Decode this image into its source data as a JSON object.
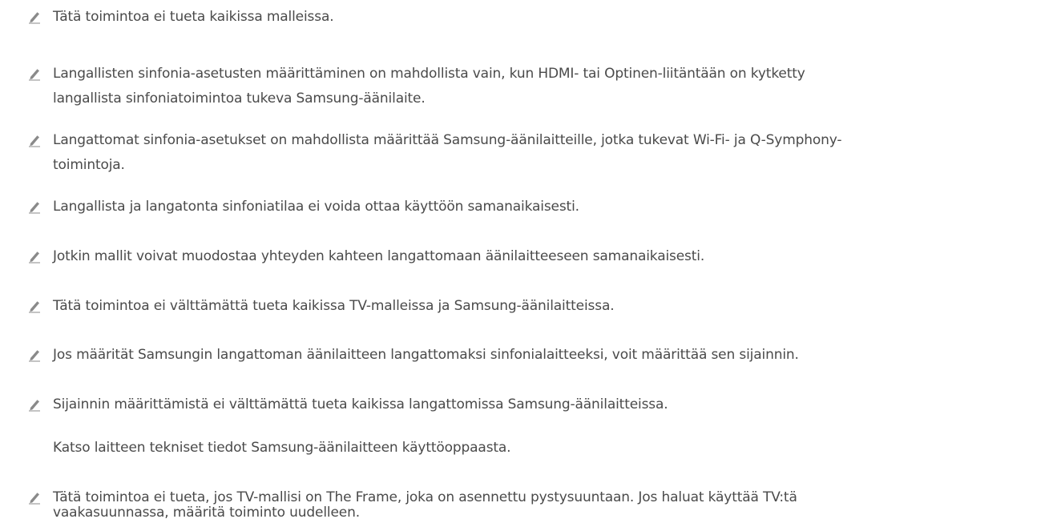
{
  "notes": [
    {
      "lines": [
        "Tätä toimintoa ei tueta kaikissa malleissa."
      ],
      "icon": "pencil-note-icon"
    },
    {
      "lines": [
        "Langallisten sinfonia-asetusten määrittäminen on mahdollista vain, kun HDMI- tai Optinen-liitäntään on kytketty",
        "langallista sinfoniatoimintoa tukeva Samsung-äänilaite."
      ],
      "icon": "pencil-note-icon"
    },
    {
      "lines": [
        "Langattomat sinfonia-asetukset on mahdollista määrittää Samsung-äänilaitteille, jotka tukevat Wi-Fi- ja Q-Symphony-",
        "toimintoja."
      ],
      "icon": "pencil-note-icon"
    },
    {
      "lines": [
        "Langallista ja langatonta sinfoniatilaa ei voida ottaa käyttöön samanaikaisesti."
      ],
      "icon": "pencil-note-icon"
    },
    {
      "lines": [
        "Jotkin mallit voivat muodostaa yhteyden kahteen langattomaan äänilaitteeseen samanaikaisesti."
      ],
      "icon": "pencil-note-icon"
    },
    {
      "lines": [
        "Tätä toimintoa ei välttämättä tueta kaikissa TV-malleissa ja Samsung-äänilaitteissa."
      ],
      "icon": "pencil-note-icon"
    },
    {
      "lines": [
        "Jos määrität Samsungin langattoman äänilaitteen langattomaksi sinfonialaitteeksi, voit määrittää sen sijainnin."
      ],
      "icon": "pencil-note-icon"
    },
    {
      "lines": [
        "Sijainnin määrittämistä ei välttämättä tueta kaikissa langattomissa Samsung-äänilaitteissa.",
        "Katso laitteen tekniset tiedot Samsung-äänilaitteen käyttöoppaasta."
      ],
      "icon": "pencil-note-icon"
    },
    {
      "lines": [
        "Tätä toimintoa ei tueta, jos TV-mallisi on The Frame, joka on asennettu pystysuuntaan. Jos haluat käyttää TV:tä",
        "vaakasuunnassa, määritä toiminto uudelleen."
      ],
      "icon": "pencil-note-icon"
    }
  ],
  "colors": {
    "text": "#4a4a4a",
    "icon": "#8a8a8a"
  }
}
